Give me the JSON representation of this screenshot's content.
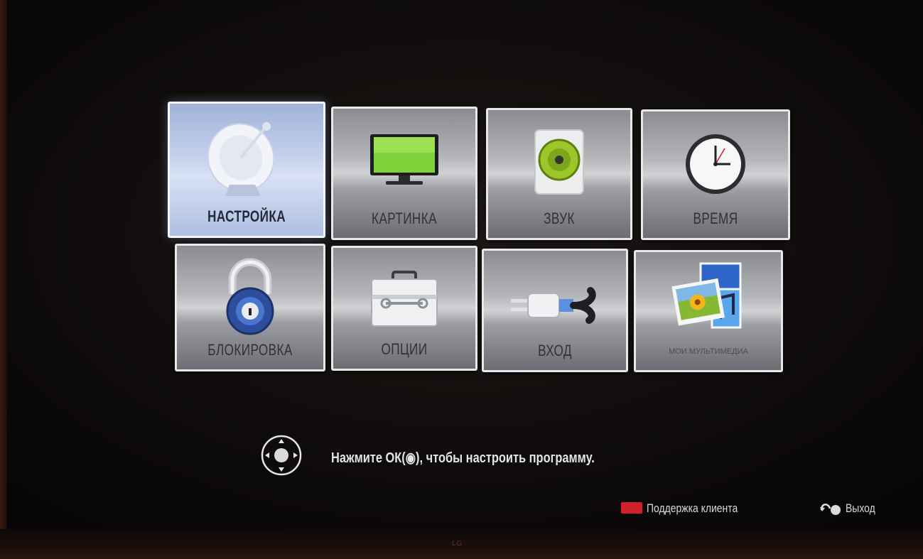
{
  "menu": {
    "tiles": [
      {
        "label": "НАСТРОЙКА",
        "icon": "satellite-dish-icon",
        "selected": true
      },
      {
        "label": "КАРТИНКА",
        "icon": "tv-screen-icon",
        "selected": false
      },
      {
        "label": "ЗВУК",
        "icon": "speaker-icon",
        "selected": false
      },
      {
        "label": "ВРЕМЯ",
        "icon": "clock-icon",
        "selected": false
      },
      {
        "label": "БЛОКИРОВКА",
        "icon": "padlock-icon",
        "selected": false
      },
      {
        "label": "ОПЦИИ",
        "icon": "toolbox-icon",
        "selected": false
      },
      {
        "label": "ВХОД",
        "icon": "input-plug-icon",
        "selected": false
      },
      {
        "label": "МОИ МУЛЬТИМЕДИА",
        "icon": "media-photos-icon",
        "selected": false
      }
    ]
  },
  "hint": {
    "text": "Нажмите ОК(◉), чтобы настроить программу.",
    "icon": "dpad-icon"
  },
  "footer": {
    "support_label": "Поддержка клиента",
    "support_key_color": "#d2202a",
    "exit_label": "Выход",
    "exit_icon": "back-return-icon"
  },
  "brand": {
    "logo_text": "LG"
  },
  "colors": {
    "selected_tile": "#c4d1ec",
    "tile_border": "#e8e8ea",
    "background": "#100d0c"
  }
}
